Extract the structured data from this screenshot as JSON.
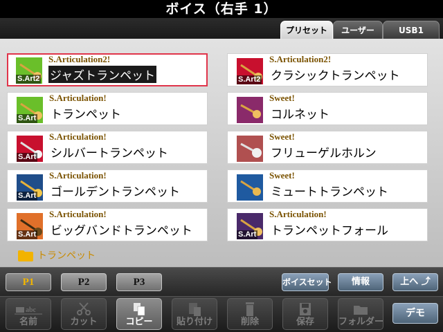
{
  "title": "ボイス（右手 1）",
  "tabs": [
    {
      "label": "プリセット",
      "active": true
    },
    {
      "label": "ユーザー",
      "active": false
    },
    {
      "label": "USB1",
      "active": false
    }
  ],
  "voices": [
    {
      "type": "S.Articulation2!",
      "name": "ジャズトランペット",
      "badge": "S.Art2",
      "icon_color": "#6abf2a",
      "selected": true
    },
    {
      "type": "S.Articulation2!",
      "name": "クラシックトランペット",
      "badge": "S.Art2",
      "icon_color": "#c8102e",
      "selected": false
    },
    {
      "type": "S.Articulation!",
      "name": "トランペット",
      "badge": "S.Art",
      "icon_color": "#6abf2a",
      "selected": false
    },
    {
      "type": "Sweet!",
      "name": "コルネット",
      "badge": "",
      "icon_color": "#8a2a6a",
      "selected": false
    },
    {
      "type": "S.Articulation!",
      "name": "シルバートランペット",
      "badge": "S.Art",
      "icon_color": "#c8102e",
      "selected": false
    },
    {
      "type": "Sweet!",
      "name": "フリューゲルホルン",
      "badge": "",
      "icon_color": "#b05050",
      "selected": false
    },
    {
      "type": "S.Articulation!",
      "name": "ゴールデントランペット",
      "badge": "S.Art",
      "icon_color": "#1f4d8a",
      "selected": false
    },
    {
      "type": "Sweet!",
      "name": "ミュートトランペット",
      "badge": "",
      "icon_color": "#1f5aa0",
      "selected": false
    },
    {
      "type": "S.Articulation!",
      "name": "ビッグバンドトランペット",
      "badge": "S.Art",
      "icon_color": "#e0702a",
      "selected": false
    },
    {
      "type": "S.Articulation!",
      "name": "トランペットフォール",
      "badge": "S.Art",
      "icon_color": "#4a2a6a",
      "selected": false
    }
  ],
  "folder": {
    "label": "トランペット"
  },
  "pages": [
    {
      "label": "P1",
      "active": true
    },
    {
      "label": "P2",
      "active": false
    },
    {
      "label": "P3",
      "active": false
    }
  ],
  "nav_buttons": {
    "voice_set": "ボイスセット",
    "info": "情報",
    "up": "上へ"
  },
  "functions": [
    {
      "label": "名前",
      "icon": "abc-icon",
      "enabled": false
    },
    {
      "label": "カット",
      "icon": "scissors-icon",
      "enabled": false
    },
    {
      "label": "コピー",
      "icon": "copy-icon",
      "enabled": true
    },
    {
      "label": "貼り付け",
      "icon": "paste-icon",
      "enabled": false
    },
    {
      "label": "削除",
      "icon": "trash-icon",
      "enabled": false
    },
    {
      "label": "保存",
      "icon": "save-icon",
      "enabled": false
    },
    {
      "label": "フォルダー",
      "icon": "folder-icon",
      "enabled": false
    }
  ],
  "demo_button": "デモ"
}
